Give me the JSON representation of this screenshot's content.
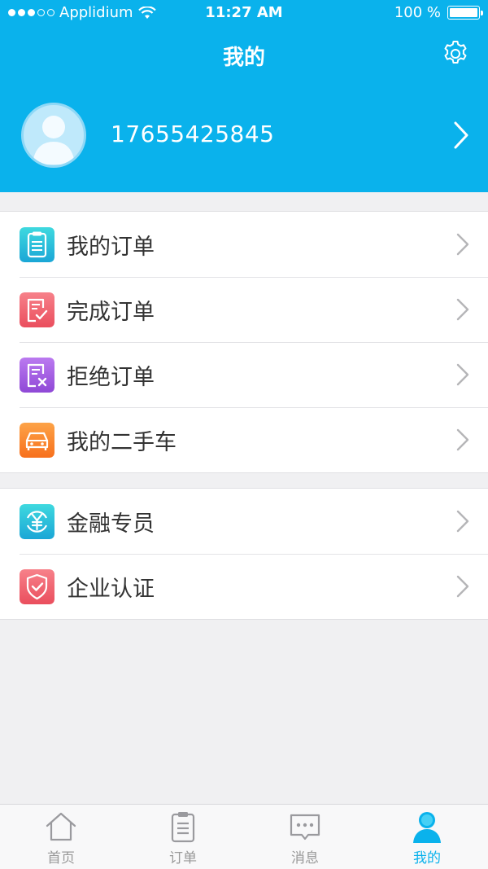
{
  "status_bar": {
    "carrier": "Applidium",
    "time": "11:27 AM",
    "battery": "100 %"
  },
  "header": {
    "title": "我的",
    "settings_icon": "gear-icon"
  },
  "profile": {
    "phone": "17655425845",
    "avatar_icon": "avatar-placeholder-icon"
  },
  "menu_group_1": [
    {
      "label": "我的订单",
      "icon": "order-list-icon",
      "color": "#2cc6d8"
    },
    {
      "label": "完成订单",
      "icon": "order-complete-icon",
      "color": "#f0646e"
    },
    {
      "label": "拒绝订单",
      "icon": "order-reject-icon",
      "color": "#a65fe0"
    },
    {
      "label": "我的二手车",
      "icon": "car-icon",
      "color": "#fb8a2e"
    }
  ],
  "menu_group_2": [
    {
      "label": "金融专员",
      "icon": "yuan-icon",
      "color": "#2cc6d8"
    },
    {
      "label": "企业认证",
      "icon": "shield-check-icon",
      "color": "#f0646e"
    }
  ],
  "tabbar": {
    "items": [
      {
        "label": "首页",
        "icon": "home-icon"
      },
      {
        "label": "订单",
        "icon": "clipboard-icon"
      },
      {
        "label": "消息",
        "icon": "message-icon"
      },
      {
        "label": "我的",
        "icon": "user-icon"
      }
    ],
    "active": "我的",
    "active_color": "#0ab2ec"
  },
  "colors": {
    "header_bg": "#0ab2ec",
    "page_bg": "#f0f0f2"
  }
}
